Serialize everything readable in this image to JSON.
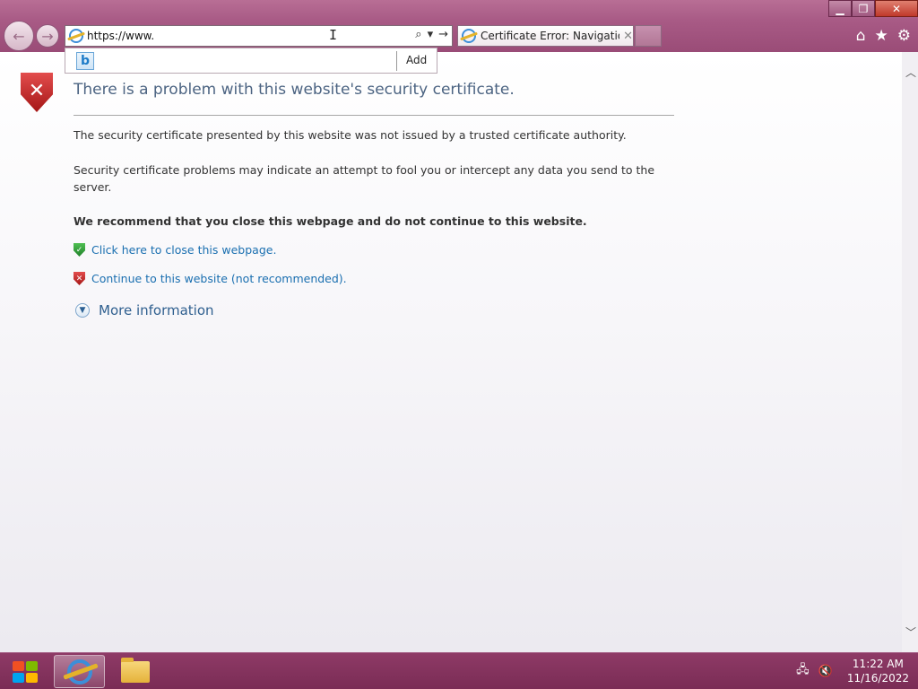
{
  "browser": {
    "address_value": "https://www.",
    "tab_title": "Certificate Error: Navigation...",
    "dropdown_action": "Add"
  },
  "page": {
    "heading": "There is a problem with this website's security certificate.",
    "para1": "The security certificate presented by this website was not issued by a trusted certificate authority.",
    "para2": "Security certificate problems may indicate an attempt to fool you or intercept any data you send to the server.",
    "recommend": "We recommend that you close this webpage and do not continue to this website.",
    "close_link": "Click here to close this webpage.",
    "continue_link": "Continue to this website (not recommended).",
    "more_info": "More information"
  },
  "taskbar": {
    "time": "11:22 AM",
    "date": "11/16/2022"
  },
  "icons": {
    "back": "back-arrow-icon",
    "forward": "forward-arrow-icon",
    "home": "home-icon",
    "favorites": "star-icon",
    "tools": "gear-icon",
    "search": "search-icon",
    "go": "go-arrow-icon"
  },
  "colors": {
    "link": "#1a6fb0",
    "heading": "#4c6482",
    "chrome": "#a85a85"
  }
}
